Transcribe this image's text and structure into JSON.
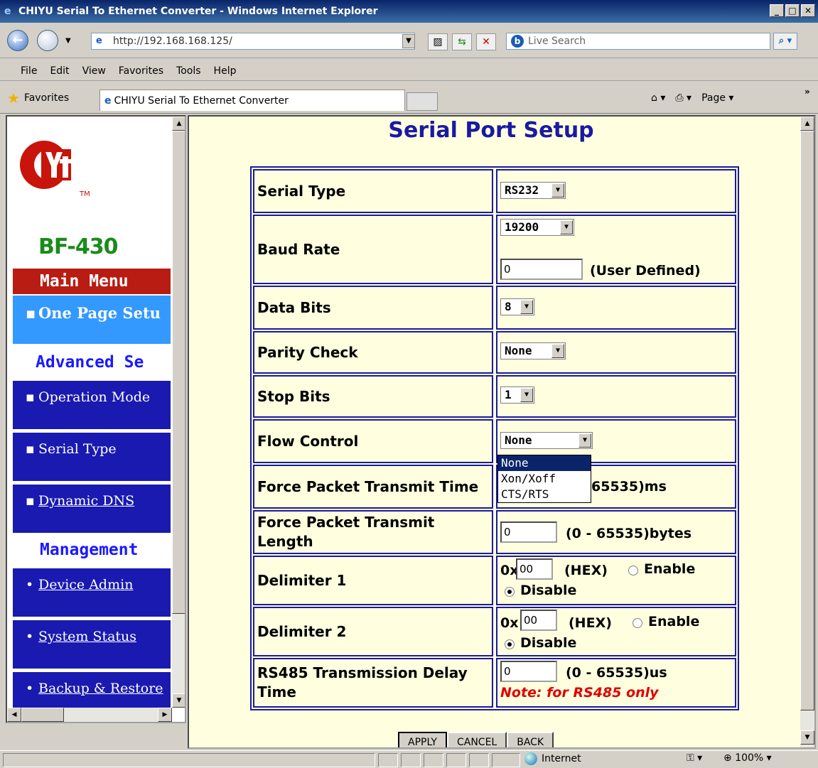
{
  "window": {
    "title": "CHIYU Serial To Ethernet Converter - Windows Internet Explorer"
  },
  "address": {
    "url": "http://192.168.168.125/",
    "search_placeholder": "Live Search"
  },
  "menubar": [
    "File",
    "Edit",
    "View",
    "Favorites",
    "Tools",
    "Help"
  ],
  "favorites": {
    "label": "Favorites",
    "tab_title": "CHIYU Serial To Ethernet Converter",
    "page_label": "Page"
  },
  "sidebar": {
    "logo_tm": "TM",
    "model": "BF-430",
    "main_menu": "Main Menu",
    "one_page": "One Page Setu",
    "advanced": "Advanced Se",
    "items": [
      "Operation Mode",
      "Serial Type",
      "Dynamic DNS"
    ],
    "management": "Management",
    "mgmt_items": [
      "Device Admin",
      "System Status",
      "Backup & Restore"
    ]
  },
  "page": {
    "title": "Serial Port Setup",
    "rows": {
      "serial_type": {
        "label": "Serial Type",
        "value": "RS232"
      },
      "baud_rate": {
        "label": "Baud Rate",
        "value": "19200",
        "custom": "0",
        "custom_label": "(User Defined)"
      },
      "data_bits": {
        "label": "Data Bits",
        "value": "8"
      },
      "parity": {
        "label": "Parity Check",
        "value": "None"
      },
      "stop_bits": {
        "label": "Stop Bits",
        "value": "1"
      },
      "flow": {
        "label": "Flow Control",
        "value": "None",
        "options": [
          "None",
          "Xon/Xoff",
          "CTS/RTS"
        ]
      },
      "force_time": {
        "label": "Force Packet Transmit Time",
        "suffix": "65535)ms"
      },
      "force_len": {
        "label": "Force Packet Transmit Length",
        "value": "0",
        "range": "(0 - 65535)bytes"
      },
      "delim1": {
        "label": "Delimiter 1",
        "prefix": "0x",
        "value": "00",
        "hex": "(HEX)",
        "enable": "Enable",
        "disable": "Disable"
      },
      "delim2": {
        "label": "Delimiter 2",
        "prefix": "0x",
        "value": "00",
        "hex": "(HEX)",
        "enable": "Enable",
        "disable": "Disable"
      },
      "rs485": {
        "label": "RS485 Transmission Delay Time",
        "value": "0",
        "range": "(0 - 65535)us",
        "note": "Note: for RS485 only"
      }
    },
    "buttons": {
      "apply": "APPLY",
      "cancel": "CANCEL",
      "back": "BACK"
    }
  },
  "status": {
    "zone": "Internet",
    "zoom": "100%"
  }
}
